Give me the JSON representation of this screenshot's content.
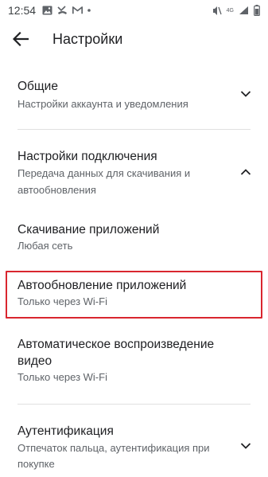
{
  "status_bar": {
    "time": "12:54",
    "network": "4G",
    "battery_icon": "battery-icon",
    "icons_left": [
      "image-icon",
      "missed-call-icon",
      "gmail-icon",
      "dot-icon"
    ],
    "icons_right": [
      "mute-icon",
      "signal-icon",
      "battery-icon"
    ]
  },
  "appbar": {
    "title": "Настройки",
    "back_icon": "back-arrow-icon"
  },
  "settings": {
    "general": {
      "title": "Общие",
      "subtitle": "Настройки аккаунта и уведомления",
      "expanded": false
    },
    "connection": {
      "title": "Настройки подключения",
      "subtitle_line1": "Передача данных для скачивания и",
      "subtitle_line2": "автообновления",
      "expanded": true
    },
    "download": {
      "title": "Скачивание приложений",
      "subtitle": "Любая сеть"
    },
    "autoupdate": {
      "title": "Автообновление приложений",
      "subtitle": "Только через Wi-Fi",
      "highlighted": true
    },
    "autoplay": {
      "title_line1": "Автоматическое воспроизведение",
      "title_line2": "видео",
      "subtitle": "Только через Wi-Fi"
    },
    "auth": {
      "title": "Аутентификация",
      "subtitle_line1": "Отпечаток пальца, аутентификация при",
      "subtitle_line2": "покупке",
      "expanded": false
    }
  },
  "colors": {
    "highlight": "#d9262f",
    "text_primary": "#202124",
    "text_secondary": "#5f6368"
  }
}
